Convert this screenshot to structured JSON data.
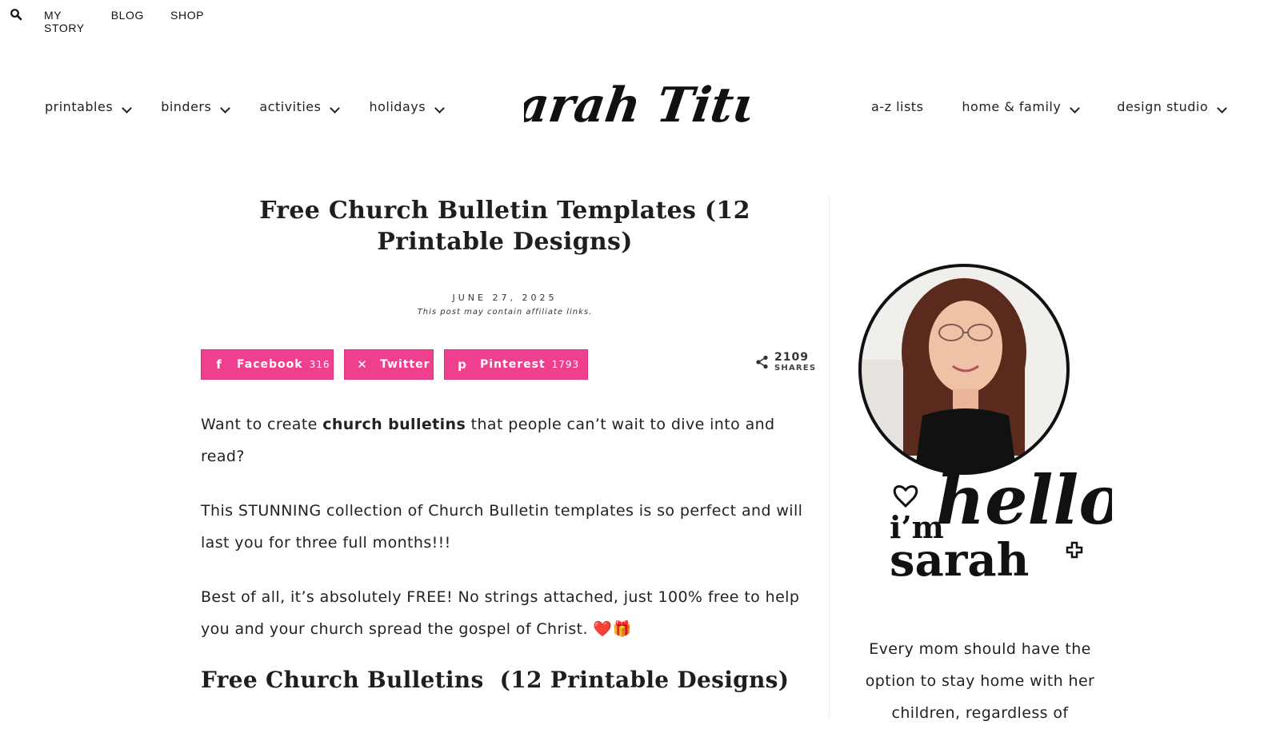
{
  "topbar": {
    "links": [
      "MY STORY",
      "BLOG",
      "SHOP"
    ]
  },
  "nav": {
    "left": [
      "printables",
      "binders",
      "activities",
      "holidays"
    ],
    "right": [
      {
        "label": "a-z lists",
        "has_dropdown": false
      },
      {
        "label": "home & family",
        "has_dropdown": true
      },
      {
        "label": "design studio",
        "has_dropdown": true
      }
    ]
  },
  "logo_text": "Sarah Titus",
  "article": {
    "title": "Free Church Bulletin Templates (12 Printable Designs)",
    "date": "JUNE 27, 2025",
    "affiliate": "This post may contain affiliate links.",
    "share": {
      "facebook": {
        "label": "Facebook",
        "count": "316"
      },
      "twitter": {
        "label": "Twitter"
      },
      "pinterest": {
        "label": "Pinterest",
        "count": "1793"
      },
      "total": "2109",
      "total_label": "SHARES"
    },
    "p1_before": "Want to create ",
    "p1_bold": "church bulletins",
    "p1_after": " that people can’t wait to dive into and read?",
    "p2": "This STUNNING collection of Church Bulletin templates is so perfect and will last you for three full months!!!",
    "p3": "Best of all, it’s absolutely FREE! No strings attached, just 100% free to help you and your church spread the gospel of Christ. ❤️🎁",
    "h2": "Free Church Bulletins  (12 Printable Designs)"
  },
  "sidebar": {
    "hello_line1": "hello",
    "hello_line2": "i’m",
    "hello_line3": "sarah",
    "intro": "Every mom should have the option to stay home with her children, regardless of"
  },
  "colors": {
    "share_pink": "#ef3f8f",
    "text": "#222222"
  }
}
